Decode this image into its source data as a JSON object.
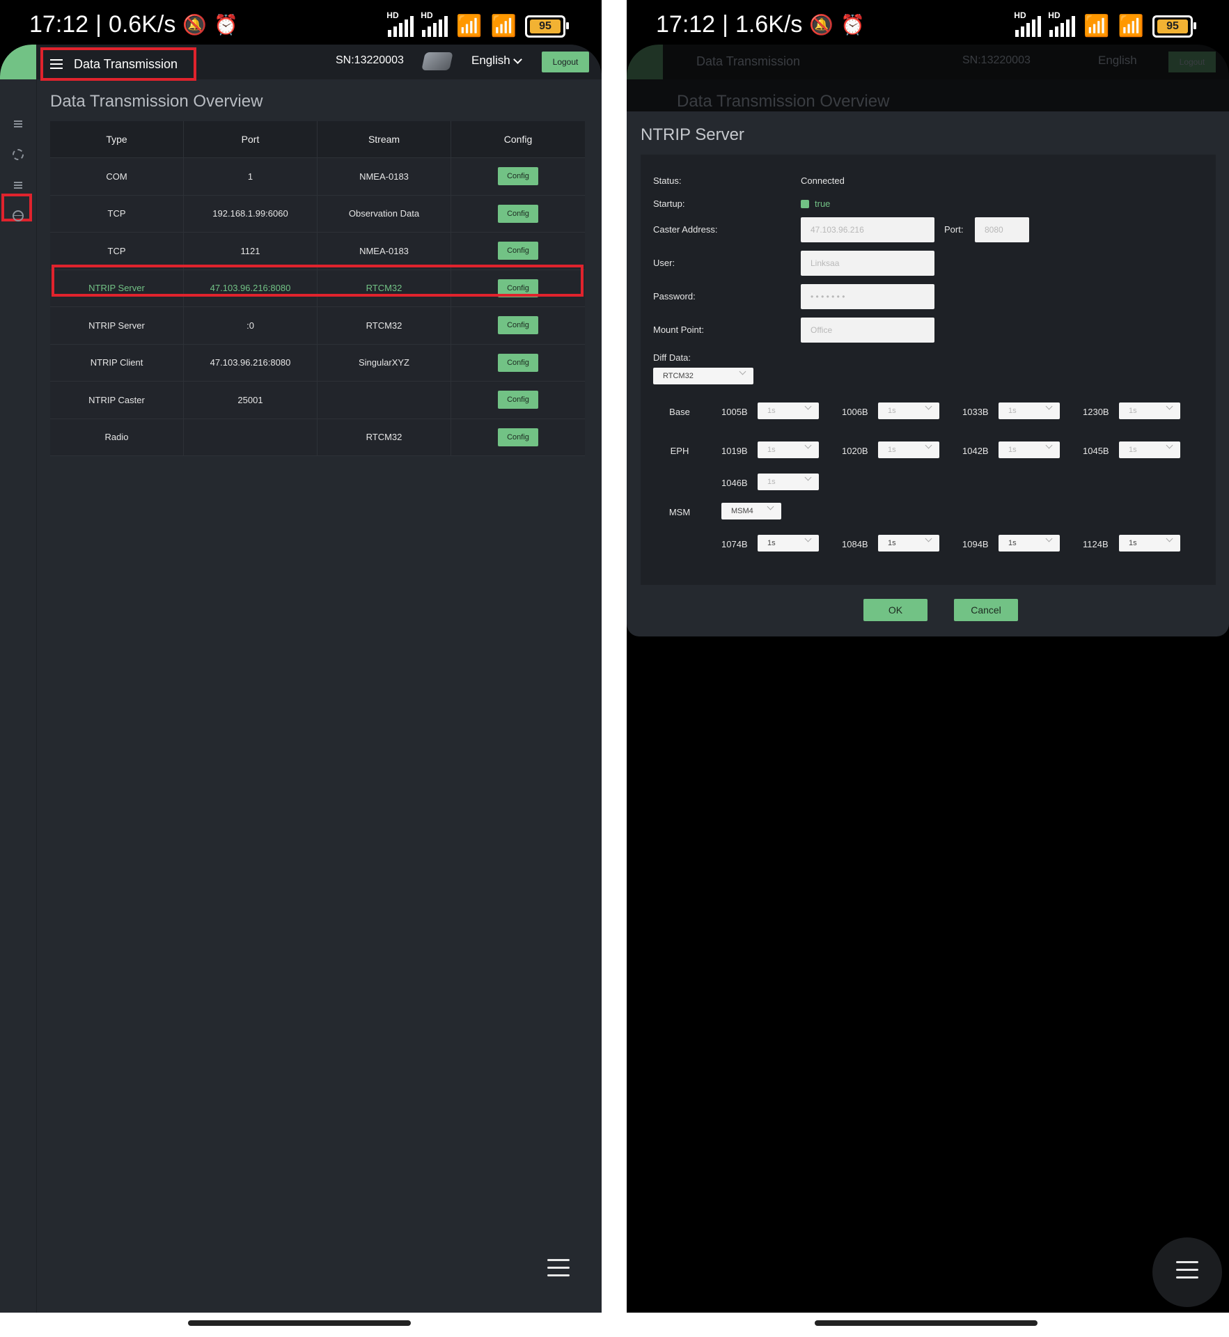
{
  "left": {
    "status": {
      "time": "17:12",
      "separator": "|",
      "speed": "0.6K/s",
      "battery": "95",
      "hd1": "HD",
      "hd2": "HD"
    },
    "header": {
      "title": "Data Transmission",
      "sn": "SN:13220003",
      "language": "English",
      "logout": "Logout"
    },
    "page_title": "Data Transmission Overview",
    "table": {
      "columns": [
        "Type",
        "Port",
        "Stream",
        "Config"
      ],
      "rows": [
        {
          "type": "COM",
          "port": "1",
          "stream": "NMEA-0183",
          "config": "Config"
        },
        {
          "type": "TCP",
          "port": "192.168.1.99:6060",
          "stream": "Observation Data",
          "config": "Config"
        },
        {
          "type": "TCP",
          "port": "1121",
          "stream": "NMEA-0183",
          "config": "Config"
        },
        {
          "type": "NTRIP Server",
          "port": "47.103.96.216:8080",
          "stream": "RTCM32",
          "config": "Config"
        },
        {
          "type": "NTRIP Server",
          "port": ":0",
          "stream": "RTCM32",
          "config": "Config"
        },
        {
          "type": "NTRIP Client",
          "port": "47.103.96.216:8080",
          "stream": "SingularXYZ",
          "config": "Config"
        },
        {
          "type": "NTRIP Caster",
          "port": "25001",
          "stream": "",
          "config": "Config"
        },
        {
          "type": "Radio",
          "port": "",
          "stream": "RTCM32",
          "config": "Config"
        }
      ]
    }
  },
  "right": {
    "status": {
      "time": "17:12",
      "separator": "|",
      "speed": "1.6K/s",
      "battery": "95",
      "hd1": "HD",
      "hd2": "HD"
    },
    "background_header": {
      "title": "Data Transmission",
      "sn": "SN:13220003",
      "language": "English",
      "logout": "Logout",
      "page_title": "Data Transmission Overview"
    },
    "dialog": {
      "title": "NTRIP Server",
      "status_label": "Status:",
      "status_value": "Connected",
      "startup_label": "Startup:",
      "startup_value": "true",
      "caster_label": "Caster Address:",
      "caster_value": "47.103.96.216",
      "port_label": "Port:",
      "port_value": "8080",
      "user_label": "User:",
      "user_value": "Linksaa",
      "password_label": "Password:",
      "password_value": "•  •  •  •  •  •  •",
      "mount_label": "Mount Point:",
      "mount_value": "Office",
      "diff_label": "Diff Data:",
      "diff_value": "RTCM32",
      "groups": {
        "base": "Base",
        "eph": "EPH",
        "msm": "MSM"
      },
      "msm_value": "MSM4",
      "base_msgs": [
        {
          "name": "1005B",
          "rate": "1s"
        },
        {
          "name": "1006B",
          "rate": "1s"
        },
        {
          "name": "1033B",
          "rate": "1s"
        },
        {
          "name": "1230B",
          "rate": "1s"
        }
      ],
      "eph_msgs": [
        {
          "name": "1019B",
          "rate": "1s"
        },
        {
          "name": "1020B",
          "rate": "1s"
        },
        {
          "name": "1042B",
          "rate": "1s"
        },
        {
          "name": "1045B",
          "rate": "1s"
        },
        {
          "name": "1046B",
          "rate": "1s"
        }
      ],
      "msm_msgs": [
        {
          "name": "1074B",
          "rate": "1s"
        },
        {
          "name": "1084B",
          "rate": "1s"
        },
        {
          "name": "1094B",
          "rate": "1s"
        },
        {
          "name": "1124B",
          "rate": "1s"
        }
      ],
      "ok": "OK",
      "cancel": "Cancel"
    }
  },
  "colors": {
    "accent": "#72c285",
    "highlight": "#e0232d",
    "panel": "#25292f"
  }
}
